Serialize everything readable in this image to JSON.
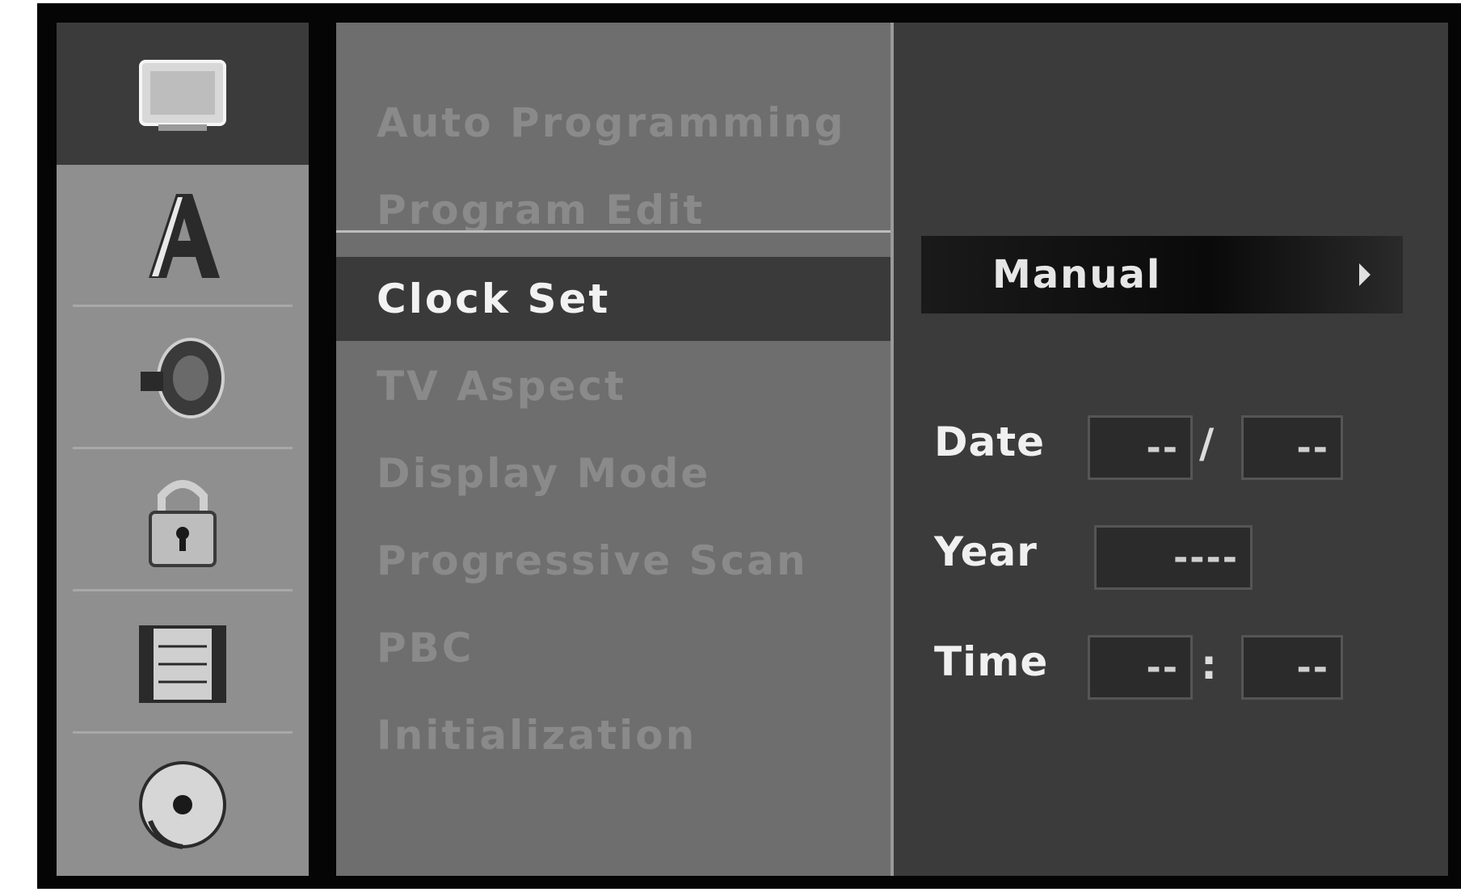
{
  "sidebar": {
    "icons": [
      "tv-icon",
      "language-a-icon",
      "speaker-icon",
      "lock-icon",
      "film-icon",
      "disc-icon"
    ]
  },
  "menu": {
    "items": [
      {
        "label": "Auto Programming"
      },
      {
        "label": "Program Edit"
      },
      {
        "label": "Clock Set"
      },
      {
        "label": "TV Aspect"
      },
      {
        "label": "Display Mode"
      },
      {
        "label": "Progressive Scan"
      },
      {
        "label": "PBC"
      },
      {
        "label": "Initialization"
      }
    ],
    "selected_index": 2
  },
  "clock": {
    "mode_label": "Manual",
    "date_label": "Date",
    "date_sep": "/",
    "date_day": "--",
    "date_month": "--",
    "year_label": "Year",
    "year_value": "----",
    "time_label": "Time",
    "time_sep": ":",
    "time_hour": "--",
    "time_min": "--"
  }
}
